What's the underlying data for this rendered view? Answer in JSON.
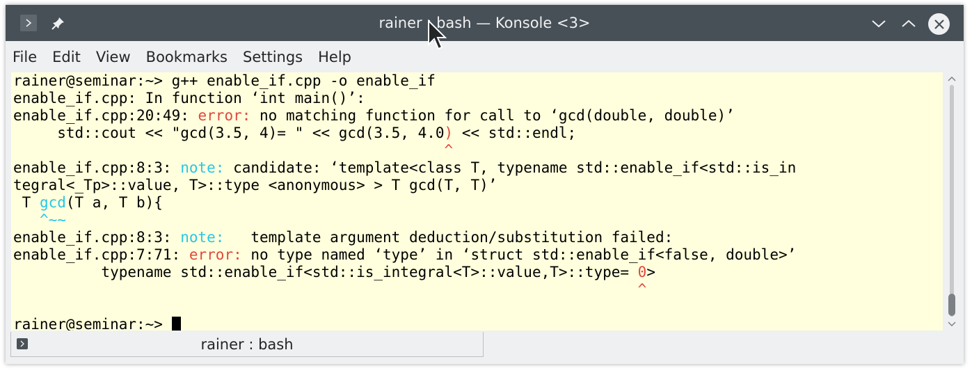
{
  "window": {
    "title": "rainer : bash — Konsole <3>"
  },
  "menubar": {
    "items": [
      "File",
      "Edit",
      "View",
      "Bookmarks",
      "Settings",
      "Help"
    ]
  },
  "terminal": {
    "background": "#ffffdd",
    "lines": [
      [
        {
          "t": "rainer@seminar:~> g++ enable_if.cpp -o enable_if"
        }
      ],
      [
        {
          "t": "enable_if.cpp: In function ‘int main()’:"
        }
      ],
      [
        {
          "t": "enable_if.cpp:20:49: "
        },
        {
          "t": "error:",
          "c": "err"
        },
        {
          "t": " no matching function for call to ‘gcd(double, double)’"
        }
      ],
      [
        {
          "t": "     std::cout << \"gcd(3.5, 4)= \" << gcd(3.5, 4.0"
        },
        {
          "t": ")",
          "c": "err"
        },
        {
          "t": " << std::endl;"
        }
      ],
      [
        {
          "t": "                                                 "
        },
        {
          "t": "^",
          "c": "err"
        }
      ],
      [
        {
          "t": "enable_if.cpp:8:3: "
        },
        {
          "t": "note:",
          "c": "note"
        },
        {
          "t": " candidate: ‘template<class T, typename std::enable_if<std::is_in"
        }
      ],
      [
        {
          "t": "tegral<_Tp>::value, T>::type <anonymous> > T gcd(T, T)’"
        }
      ],
      [
        {
          "t": " T "
        },
        {
          "t": "gcd",
          "c": "note"
        },
        {
          "t": "(T a, T b){"
        }
      ],
      [
        {
          "t": "   "
        },
        {
          "t": "^~~",
          "c": "note"
        }
      ],
      [
        {
          "t": "enable_if.cpp:8:3: "
        },
        {
          "t": "note:",
          "c": "note"
        },
        {
          "t": "   template argument deduction/substitution failed:"
        }
      ],
      [
        {
          "t": "enable_if.cpp:7:71: "
        },
        {
          "t": "error:",
          "c": "err"
        },
        {
          "t": " no type named ‘type’ in ‘struct std::enable_if<false, double>’"
        }
      ],
      [
        {
          "t": "          typename std::enable_if<std::is_integral<T>::value,T>::type= "
        },
        {
          "t": "0",
          "c": "err"
        },
        {
          "t": ">"
        }
      ],
      [
        {
          "t": "                                                                       "
        },
        {
          "t": "^",
          "c": "err"
        }
      ],
      [
        {
          "t": ""
        }
      ],
      [
        {
          "t": "rainer@seminar:~> "
        },
        {
          "cursor": true
        }
      ]
    ]
  },
  "tabs": [
    {
      "label": "rainer : bash"
    }
  ],
  "icons": {
    "menu": "terminal-menu-icon",
    "pin": "pin-icon",
    "minimize": "chevron-down-icon",
    "maximize": "chevron-up-icon",
    "close": "close-icon",
    "tab": "terminal-tab-icon"
  },
  "colors": {
    "titlebar": "#475057",
    "error": "#e0483f",
    "note": "#27c7e7"
  }
}
